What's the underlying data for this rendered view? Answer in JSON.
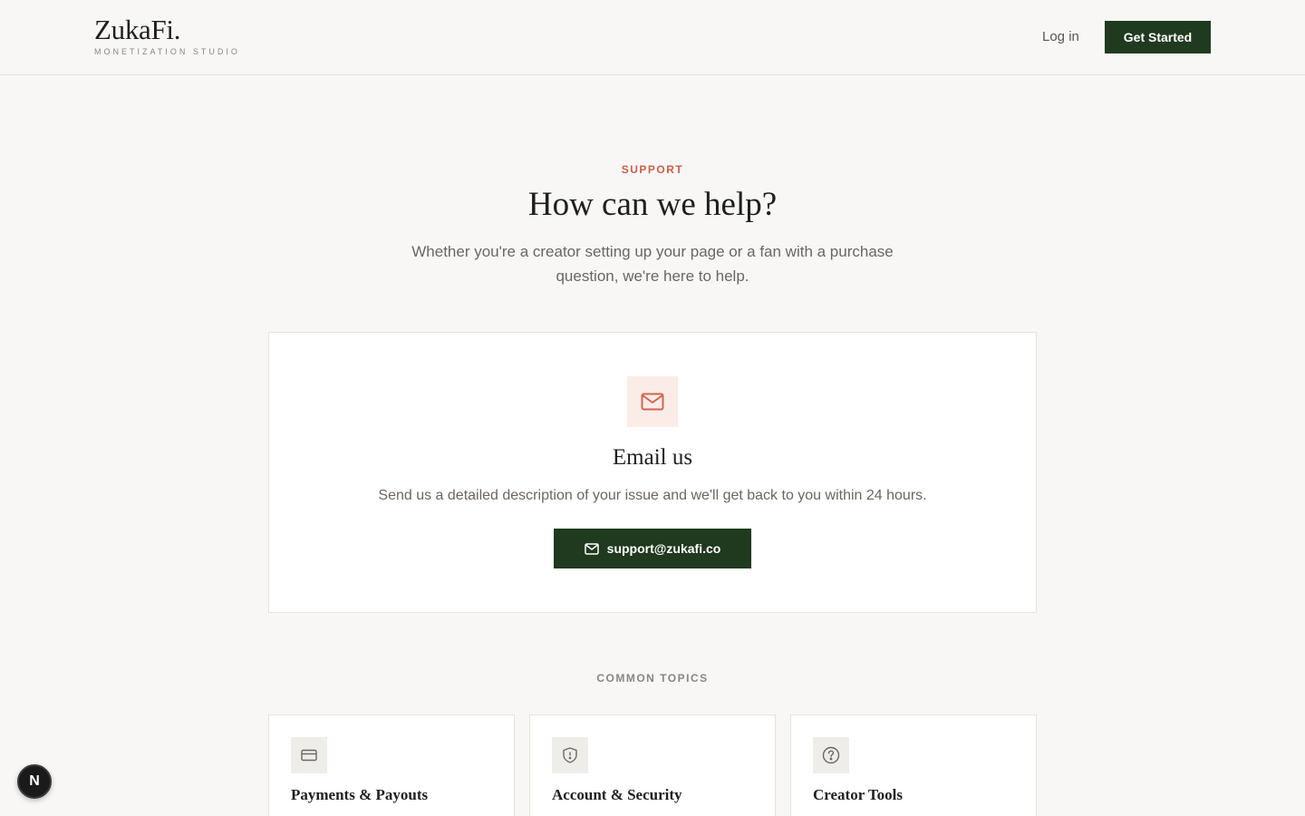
{
  "header": {
    "brand_name": "ZukaFi.",
    "brand_tagline": "MONETIZATION STUDIO",
    "login_label": "Log in",
    "cta_label": "Get Started"
  },
  "hero": {
    "eyebrow": "SUPPORT",
    "title": "How can we help?",
    "subtitle": "Whether you're a creator setting up your page or a fan with a purchase question, we're here to help."
  },
  "email_card": {
    "icon": "mail-icon",
    "title": "Email us",
    "description": "Send us a detailed description of your issue and we'll get back to you within 24 hours.",
    "button_label": "support@zukafi.co"
  },
  "topics": {
    "label": "COMMON TOPICS",
    "items": [
      {
        "title": "Payments & Payouts",
        "icon": "credit-card-icon"
      },
      {
        "title": "Account & Security",
        "icon": "shield-alert-icon"
      },
      {
        "title": "Creator Tools",
        "icon": "help-circle-icon"
      }
    ]
  },
  "floating_badge": {
    "label": "N"
  },
  "colors": {
    "background": "#f8f7f5",
    "primary_green": "#1f3a1f",
    "accent_coral": "#c9604a",
    "icon_tint": "#fbece7",
    "card_border": "#e6e3de"
  }
}
